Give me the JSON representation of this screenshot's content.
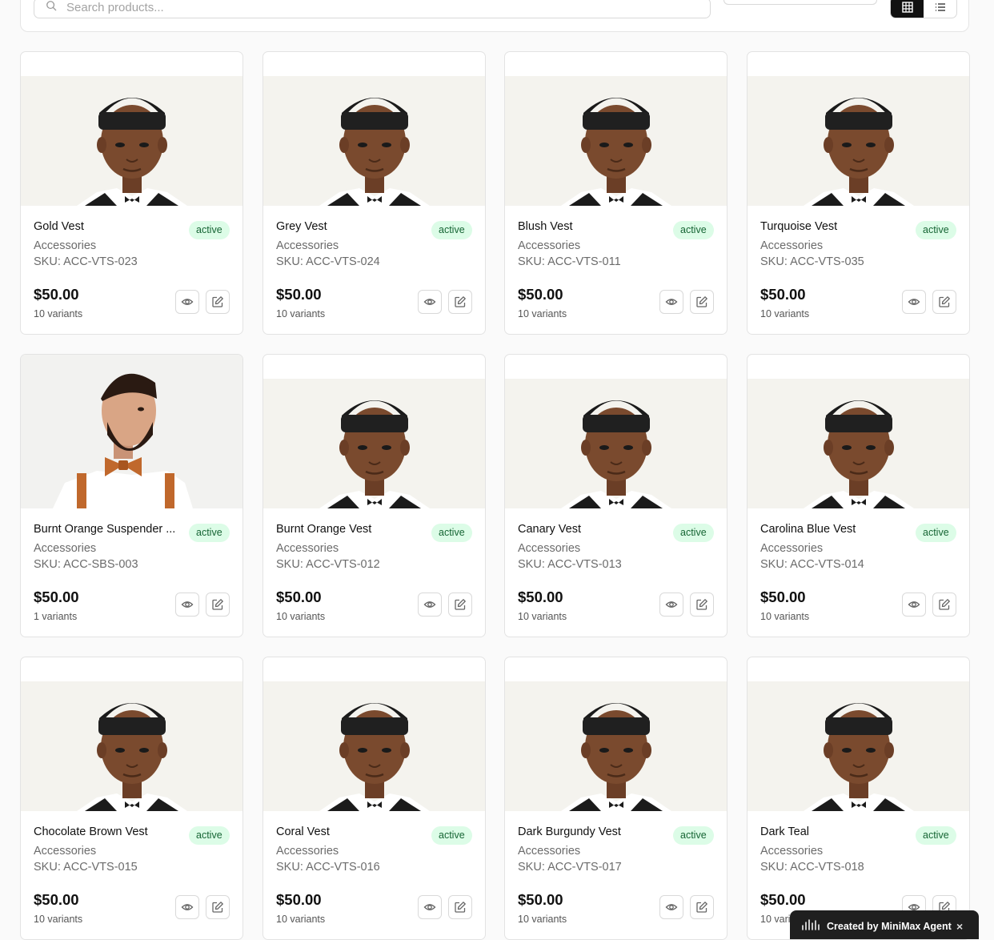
{
  "search": {
    "placeholder": "Search products..."
  },
  "view_toggle": {
    "grid": "grid-icon",
    "list": "list-icon",
    "active": "grid"
  },
  "colors": {
    "badge_bg": "#dcfce7",
    "badge_text": "#166534",
    "toggle_active": "#111111"
  },
  "products": [
    {
      "title": "Gold Vest",
      "status": "active",
      "category": "Accessories",
      "sku": "SKU: ACC-VTS-023",
      "price": "$50.00",
      "variants": "10 variants",
      "image": "vest-model"
    },
    {
      "title": "Grey Vest",
      "status": "active",
      "category": "Accessories",
      "sku": "SKU: ACC-VTS-024",
      "price": "$50.00",
      "variants": "10 variants",
      "image": "vest-model"
    },
    {
      "title": "Blush Vest",
      "status": "active",
      "category": "Accessories",
      "sku": "SKU: ACC-VTS-011",
      "price": "$50.00",
      "variants": "10 variants",
      "image": "vest-model"
    },
    {
      "title": "Turquoise Vest",
      "status": "active",
      "category": "Accessories",
      "sku": "SKU: ACC-VTS-035",
      "price": "$50.00",
      "variants": "10 variants",
      "image": "vest-model"
    },
    {
      "title": "Burnt Orange Suspender ...",
      "status": "active",
      "category": "Accessories",
      "sku": "SKU: ACC-SBS-003",
      "price": "$50.00",
      "variants": "1 variants",
      "image": "suspender-model"
    },
    {
      "title": "Burnt Orange Vest",
      "status": "active",
      "category": "Accessories",
      "sku": "SKU: ACC-VTS-012",
      "price": "$50.00",
      "variants": "10 variants",
      "image": "vest-model"
    },
    {
      "title": "Canary Vest",
      "status": "active",
      "category": "Accessories",
      "sku": "SKU: ACC-VTS-013",
      "price": "$50.00",
      "variants": "10 variants",
      "image": "vest-model"
    },
    {
      "title": "Carolina Blue Vest",
      "status": "active",
      "category": "Accessories",
      "sku": "SKU: ACC-VTS-014",
      "price": "$50.00",
      "variants": "10 variants",
      "image": "vest-model"
    },
    {
      "title": "Chocolate Brown Vest",
      "status": "active",
      "category": "Accessories",
      "sku": "SKU: ACC-VTS-015",
      "price": "$50.00",
      "variants": "10 variants",
      "image": "vest-model"
    },
    {
      "title": "Coral Vest",
      "status": "active",
      "category": "Accessories",
      "sku": "SKU: ACC-VTS-016",
      "price": "$50.00",
      "variants": "10 variants",
      "image": "vest-model"
    },
    {
      "title": "Dark Burgundy Vest",
      "status": "active",
      "category": "Accessories",
      "sku": "SKU: ACC-VTS-017",
      "price": "$50.00",
      "variants": "10 variants",
      "image": "vest-model"
    },
    {
      "title": "Dark Teal",
      "status": "active",
      "category": "Accessories",
      "sku": "SKU: ACC-VTS-018",
      "price": "$50.00",
      "variants": "10 variants",
      "image": "vest-model"
    }
  ],
  "floating_badge": {
    "label": "Created by MiniMax Agent",
    "close": "×"
  }
}
